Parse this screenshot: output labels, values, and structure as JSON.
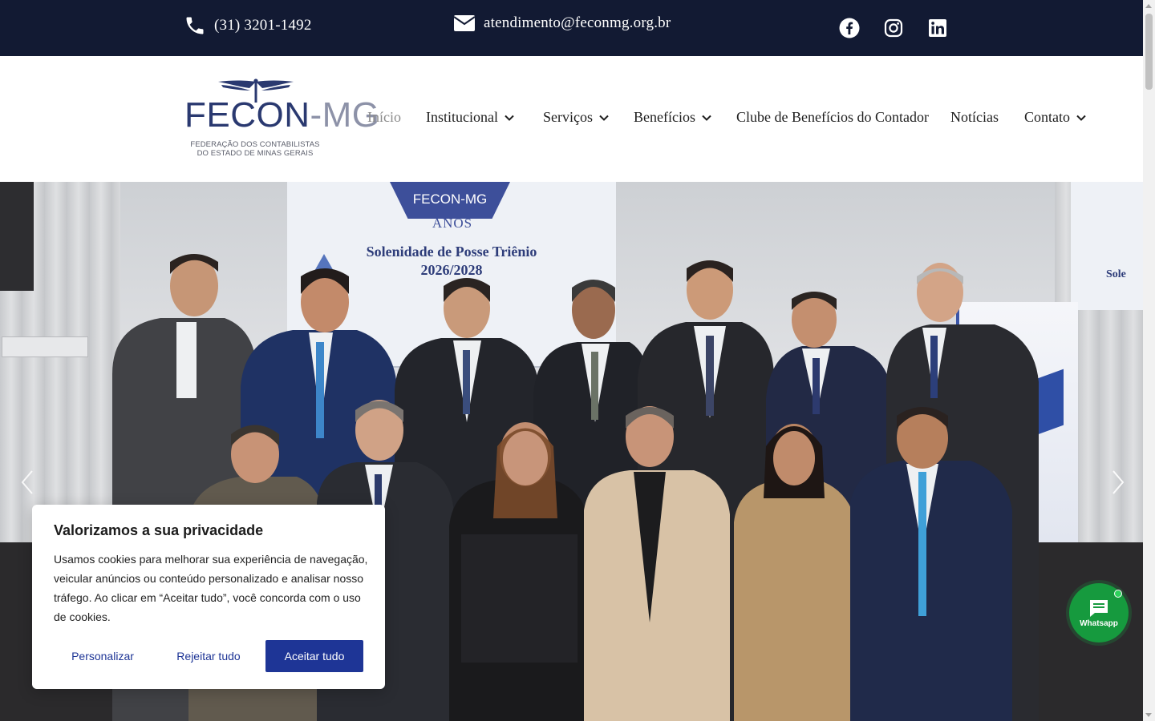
{
  "topbar": {
    "phone": "(31) 3201-1492",
    "email": "atendimento@feconmg.org.br",
    "social": [
      "facebook-icon",
      "instagram-icon",
      "linkedin-icon"
    ]
  },
  "logo": {
    "word_main": "FECON",
    "word_dash": "-",
    "word_suffix": "MG",
    "sub_line1": "FEDERAÇÃO DOS CONTABILISTAS",
    "sub_line2": "DO ESTADO DE MINAS GERAIS"
  },
  "nav": {
    "items": [
      {
        "label": "Início",
        "active": true,
        "dropdown": false
      },
      {
        "label": "Institucional",
        "dropdown": true
      },
      {
        "label": "Serviços",
        "dropdown": true
      },
      {
        "label": "Benefícios",
        "dropdown": true
      },
      {
        "label": "Clube de Benefícios do Contador",
        "dropdown": false
      },
      {
        "label": "Notícias",
        "dropdown": false
      },
      {
        "label": "Contato",
        "dropdown": true
      }
    ]
  },
  "hero": {
    "screen_banner": "FECON-MG",
    "screen_anos": "ANOS",
    "screen_title_line1": "Solenidade de Posse Triênio",
    "screen_title_line2": "2026/2028",
    "screen_side": "Sole"
  },
  "cookie": {
    "title": "Valorizamos a sua privacidade",
    "text": "Usamos cookies para melhorar sua experiência de navegação, veicular anúncios ou conteúdo personalizado e analisar nosso tráfego. Ao clicar em “Aceitar tudo”, você concorda com o uso de cookies.",
    "btn_customize": "Personalizar",
    "btn_reject": "Rejeitar tudo",
    "btn_accept": "Aceitar tudo"
  },
  "whatsapp": {
    "label": "Whatsapp"
  },
  "colors": {
    "topbar": "#121a33",
    "brand_blue": "#1e3596",
    "whatsapp_green": "#169a3e"
  }
}
